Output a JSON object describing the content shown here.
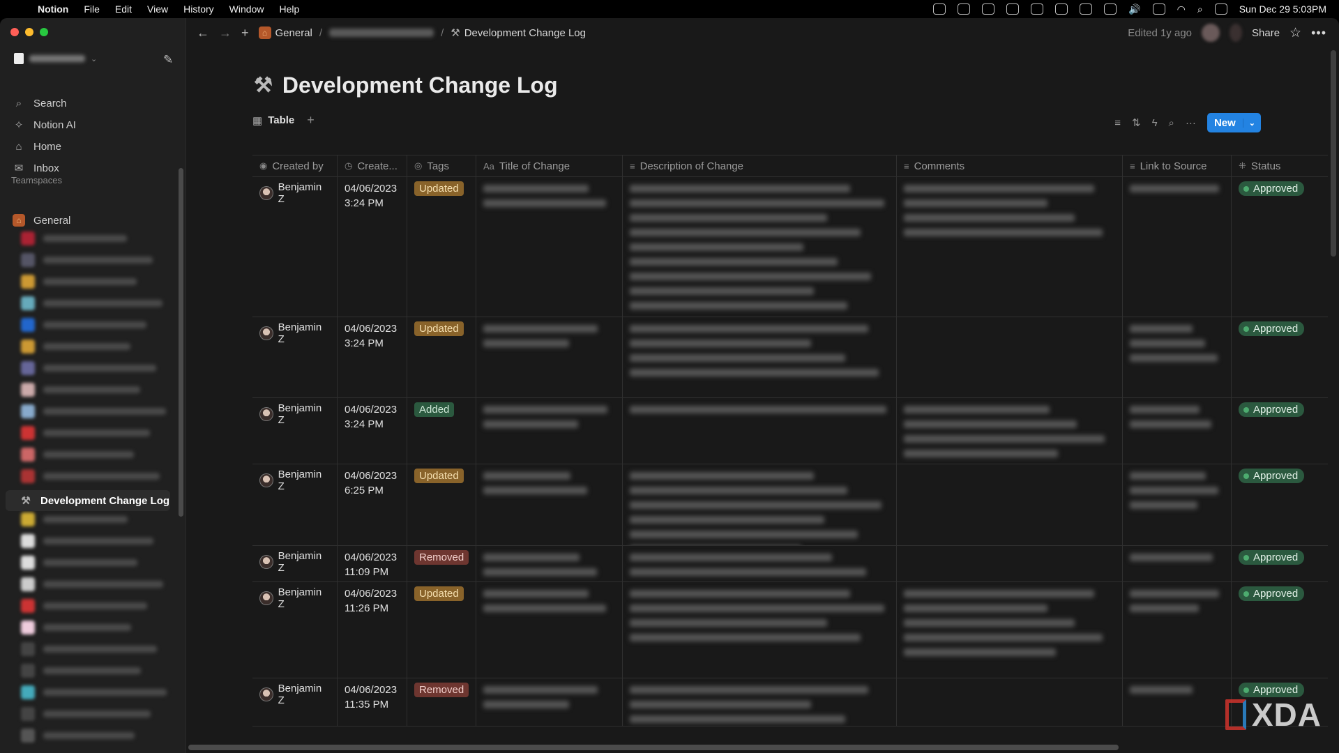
{
  "menubar": {
    "app": "Notion",
    "menus": [
      "File",
      "Edit",
      "View",
      "History",
      "Window",
      "Help"
    ],
    "clock": "Sun Dec 29  5:03PM"
  },
  "sidebar": {
    "nav": [
      {
        "label": "Search",
        "icon": "search-icon"
      },
      {
        "label": "Notion AI",
        "icon": "notion-ai-icon"
      },
      {
        "label": "Home",
        "icon": "home-icon"
      },
      {
        "label": "Inbox",
        "icon": "inbox-icon"
      }
    ],
    "teamspaces_label": "Teamspaces",
    "teamspace": "General",
    "active_page": "Development Change Log"
  },
  "topbar": {
    "breadcrumb_root": "General",
    "breadcrumb_current": "Development Change Log",
    "edited": "Edited 1y ago",
    "share": "Share"
  },
  "page": {
    "title": "Development Change Log",
    "view_tab": "Table",
    "new_button": "New"
  },
  "colors": {
    "accent": "#2383e2",
    "updated": "#89632a",
    "added": "#2b593f",
    "removed": "#6e3630",
    "approved": "#2b593f"
  },
  "columns": [
    "Created by",
    "Create...",
    "Tags",
    "Title of Change",
    "Description of Change",
    "Comments",
    "Link to Source",
    "Status"
  ],
  "rows": [
    {
      "created_by": "Benjamin Z",
      "date": "04/06/2023",
      "time": "3:24 PM",
      "tag": "Updated",
      "status": "Approved"
    },
    {
      "created_by": "Benjamin Z",
      "date": "04/06/2023",
      "time": "3:24 PM",
      "tag": "Updated",
      "status": "Approved"
    },
    {
      "created_by": "Benjamin Z",
      "date": "04/06/2023",
      "time": "3:24 PM",
      "tag": "Added",
      "status": "Approved"
    },
    {
      "created_by": "Benjamin Z",
      "date": "04/06/2023",
      "time": "6:25 PM",
      "tag": "Updated",
      "status": "Approved"
    },
    {
      "created_by": "Benjamin Z",
      "date": "04/06/2023",
      "time": "11:09 PM",
      "tag": "Removed",
      "status": "Approved"
    },
    {
      "created_by": "Benjamin Z",
      "date": "04/06/2023",
      "time": "11:26 PM",
      "tag": "Updated",
      "status": "Approved"
    },
    {
      "created_by": "Benjamin Z",
      "date": "04/06/2023",
      "time": "11:35 PM",
      "tag": "Removed",
      "status": "Approved"
    }
  ],
  "watermark": "XDA"
}
